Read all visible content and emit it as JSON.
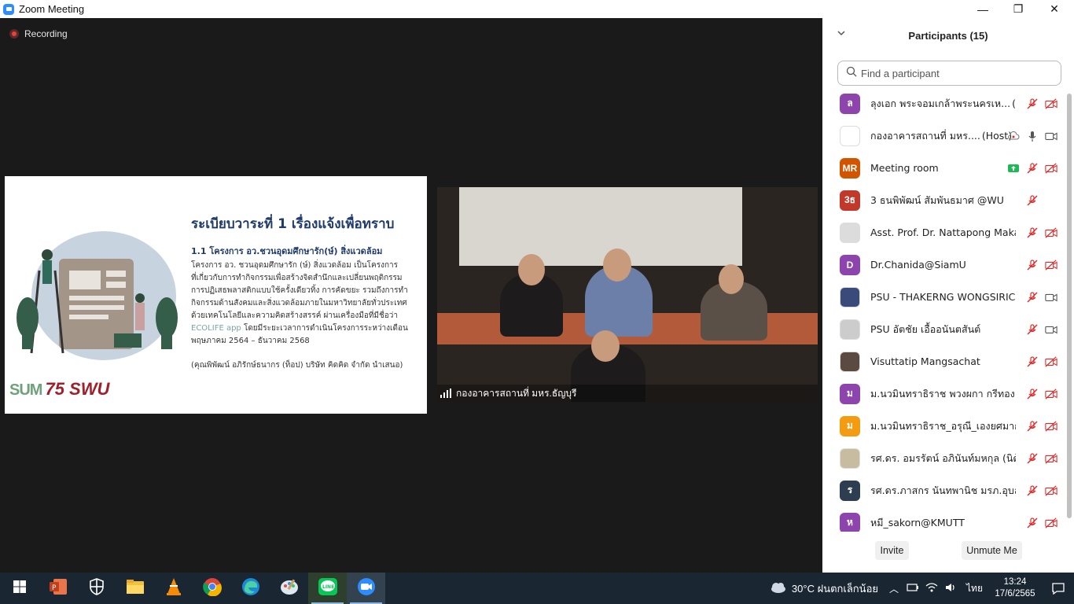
{
  "window": {
    "title": "Zoom Meeting",
    "minimize": "—",
    "maximize": "❐",
    "close": "✕"
  },
  "recording": {
    "label": "Recording"
  },
  "slide": {
    "title": "ระเบียบวาระที่ 1 เรื่องแจ้งเพื่อทราบ",
    "subtitle": "1.1 โครงการ อว.ชวนอุดมศึกษารัก(ษ์) สิ่งแวดล้อม",
    "body_lines": [
      "โครงการ อว. ชวนอุดมศึกษารัก (ษ์) สิ่งแวดล้อม เป็นโครงการ",
      "ที่เกี่ยวกับการทำกิจกรรมเพื่อสร้างจิตสำนึกและเปลี่ยนพฤติกรรม",
      "การปฏิเสธพลาสติกแบบใช้ครั้งเดียวทิ้ง การคัดขยะ รวมถึงการทำ",
      "กิจกรรมด้านสังคมและสิ่งแวดล้อมภายในมหาวิทยาลัยทั่วประเทศ",
      "ด้วยเทคโนโลยีและความคิดสร้างสรรค์ ผ่านเครื่องมือที่มีชื่อว่า"
    ],
    "body_ecolife": "ECOLIFE app",
    "body_after_ecolife": " โดยมีระยะเวลาการดำเนินโครงการระหว่างเดือน",
    "body_last": "พฤษภาคม 2564 – ธันวาคม 2568",
    "credit": "(คุณพิพัฒน์ อภิรักษ์ธนากร (ท็อป) บริษัท คิดคิด จำกัด นำเสนอ)",
    "logo_left": "SUM",
    "logo_right": "75 SWU"
  },
  "video": {
    "caption": "กองอาคารสถานที่ มหร.ธัญบุรี"
  },
  "participants": {
    "header": "Participants (15)",
    "search_placeholder": "Find a participant",
    "list": [
      {
        "name": "ลุงเอก พระจอมเกล้าพระนครเห...",
        "tag": "(Me)",
        "avatar_text": "ล",
        "avatar_color": "#8e44ad",
        "video_icon": "video-off-icon",
        "mic_icon": "mic-muted-icon"
      },
      {
        "name": "กองอาคารสถานที่ มหร....",
        "tag": "(Host)",
        "avatar_text": "",
        "avatar_color": "#ffffff",
        "video_icon": "video-on-icon",
        "mic_icon": "mic-on-icon",
        "extra_icon": "cloud-icon"
      },
      {
        "name": "Meeting room",
        "tag": "",
        "avatar_text": "MR",
        "avatar_color": "#d35400",
        "video_icon": "video-off-icon",
        "mic_icon": "mic-muted-icon",
        "extra_icon": "share-screen-icon"
      },
      {
        "name": "3 ธนพิพัฒน์ สัมพันธมาศ @WU",
        "tag": "",
        "avatar_text": "3ธ",
        "avatar_color": "#c0392b",
        "video_icon": "",
        "mic_icon": "mic-muted-icon"
      },
      {
        "name": "Asst. Prof. Dr. Nattapong Maka...",
        "tag": "",
        "avatar_text": "",
        "avatar_color": "#dcdcdc",
        "video_icon": "video-off-icon",
        "mic_icon": "mic-muted-icon"
      },
      {
        "name": "Dr.Chanida@SiamU",
        "tag": "",
        "avatar_text": "D",
        "avatar_color": "#8e44ad",
        "video_icon": "video-off-icon",
        "mic_icon": "mic-muted-icon"
      },
      {
        "name": "PSU - THAKERNG WONGSIRIC...",
        "tag": "",
        "avatar_text": "",
        "avatar_color": "#3a4a7a",
        "video_icon": "video-on-icon",
        "mic_icon": "mic-muted-icon"
      },
      {
        "name": "PSU อัตชัย เอื้ออนันตสันต์",
        "tag": "",
        "avatar_text": "",
        "avatar_color": "#cccccc",
        "video_icon": "video-on-icon",
        "mic_icon": "mic-muted-icon"
      },
      {
        "name": "Visuttatip Mangsachat",
        "tag": "",
        "avatar_text": "",
        "avatar_color": "#5a4a40",
        "video_icon": "video-off-icon",
        "mic_icon": "mic-muted-icon"
      },
      {
        "name": "ม.นวมินทราธิราช พวงผกา กรีทอง",
        "tag": "",
        "avatar_text": "ม",
        "avatar_color": "#8e44ad",
        "video_icon": "video-off-icon",
        "mic_icon": "mic-muted-icon"
      },
      {
        "name": "ม.นวมินทราธิราช_อรุณี_เองยศมาก",
        "tag": "",
        "avatar_text": "ม",
        "avatar_color": "#f39c12",
        "video_icon": "video-off-icon",
        "mic_icon": "mic-muted-icon"
      },
      {
        "name": "รศ.ดร. อมรรัตน์ อภินันท์มหกุล (นิด้า)",
        "tag": "",
        "avatar_text": "",
        "avatar_color": "#c8bca0",
        "video_icon": "video-off-icon",
        "mic_icon": "mic-muted-icon"
      },
      {
        "name": "รศ.ดร.ภาสกร นันทพานิช มรภ.อุบลร...",
        "tag": "",
        "avatar_text": "ร",
        "avatar_color": "#2c3e50",
        "video_icon": "video-off-icon",
        "mic_icon": "mic-muted-icon"
      },
      {
        "name": "หมี_sakorn@KMUTT",
        "tag": "",
        "avatar_text": "ห",
        "avatar_color": "#8e44ad",
        "video_icon": "video-off-icon",
        "mic_icon": "mic-muted-icon"
      }
    ],
    "invite_label": "Invite",
    "unmute_label": "Unmute Me"
  },
  "taskbar": {
    "apps": [
      "start-icon",
      "powerpoint-icon",
      "security-icon",
      "file-explorer-icon",
      "vlc-icon",
      "chrome-icon",
      "edge-icon",
      "paint-icon",
      "line-icon",
      "zoom-icon"
    ],
    "weather": "30°C ฝนตกเล็กน้อย",
    "language": "ไทย",
    "time": "13:24",
    "date": "17/6/2565"
  }
}
